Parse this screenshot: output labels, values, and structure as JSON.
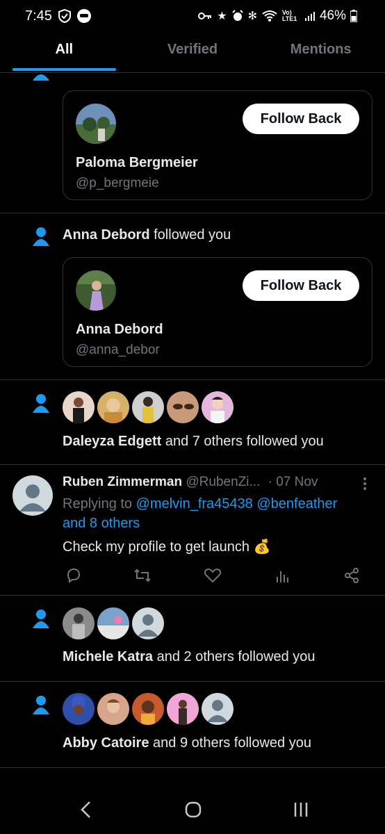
{
  "status_bar": {
    "time": "7:45",
    "lte": "Vo) LTE1",
    "battery": "46%"
  },
  "tabs": [
    {
      "label": "All",
      "active": true
    },
    {
      "label": "Verified",
      "active": false
    },
    {
      "label": "Mentions",
      "active": false
    }
  ],
  "cards": [
    {
      "name": "Paloma Bergmeier",
      "handle": "@p_bergmeie",
      "button": "Follow Back"
    },
    {
      "name": "Anna Debord",
      "handle": "@anna_debor",
      "button": "Follow Back"
    }
  ],
  "notif_anna": {
    "name": "Anna Debord",
    "text": "followed you"
  },
  "group1": {
    "name": "Daleyza Edgett",
    "text": "and 7 others followed you"
  },
  "reply": {
    "name": "Ruben Zimmerman",
    "handle": "@RubenZi...",
    "date": "· 07 Nov",
    "replying_prefix": "Replying to",
    "mentions_line1": "@melvin_fra45438 @benfeather",
    "mentions_line2": "and 8 others",
    "body": "Check my profile to get launch 💰"
  },
  "group2": {
    "name": "Michele Katra",
    "text": "and 2 others followed you"
  },
  "group3": {
    "name": "Abby Catoire",
    "text": "and 9 others followed you"
  },
  "colors": {
    "accent": "#1d9bf0",
    "bg": "#000000",
    "muted": "#71767b",
    "divider": "#2f3336"
  }
}
